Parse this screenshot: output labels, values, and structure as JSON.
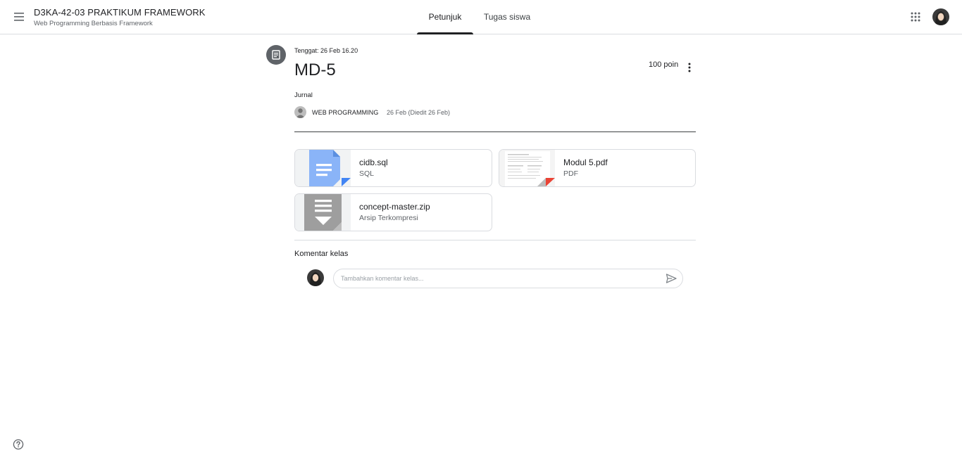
{
  "header": {
    "class_title": "D3KA-42-03 PRAKTIKUM FRAMEWORK",
    "class_subtitle": "Web Programming Berbasis Framework",
    "tabs": [
      {
        "label": "Petunjuk",
        "active": true
      },
      {
        "label": "Tugas siswa",
        "active": false
      }
    ],
    "icons": {
      "menu": "hamburger-menu-icon",
      "apps": "apps-grid-icon",
      "avatar": "user-avatar"
    }
  },
  "assignment": {
    "due": "Tenggat: 26 Feb 16.20",
    "title": "MD-5",
    "points": "100 poin",
    "topic": "Jurnal",
    "author": "WEB PROGRAMMING",
    "posted": "26 Feb (Diedit 26 Feb)",
    "icon": "assignment-icon"
  },
  "attachments": [
    {
      "name": "cidb.sql",
      "type": "SQL",
      "icon": "google-docs-file-icon",
      "corner_color": "#4285f4"
    },
    {
      "name": "Modul 5.pdf",
      "type": "PDF",
      "icon": "pdf-thumbnail",
      "corner_color": "#ea4335"
    },
    {
      "name": "concept-master.zip",
      "type": "Arsip Terkompresi",
      "icon": "archive-file-icon",
      "corner_color": "#9e9e9e"
    }
  ],
  "comments": {
    "heading": "Komentar kelas",
    "placeholder": "Tambahkan komentar kelas...",
    "send_icon": "send-icon"
  },
  "footer": {
    "help_icon": "help-icon"
  },
  "colors": {
    "text_primary": "#202124",
    "text_secondary": "#5f6368",
    "border": "#dadce0",
    "docs_blue": "#8ab4f8",
    "archive_gray": "#9e9e9e"
  }
}
